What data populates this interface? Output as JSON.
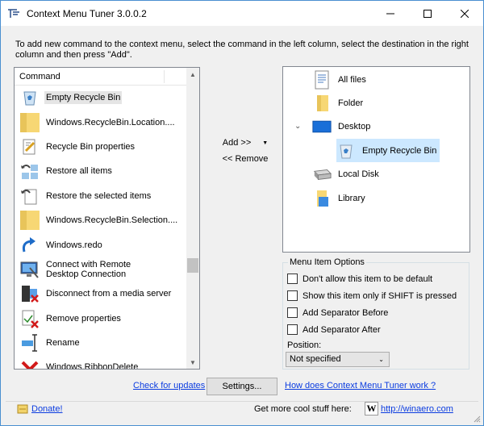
{
  "titlebar": {
    "title": "Context Menu Tuner 3.0.0.2",
    "minimize_icon": "minimize-icon",
    "maximize_icon": "maximize-icon",
    "close_icon": "close-icon"
  },
  "instruction": "To add new command to the context menu, select the command in the left column, select the destination in the right column and then press \"Add\".",
  "command_list": {
    "header": "Command",
    "items": [
      {
        "label": "Empty Recycle Bin",
        "icon": "recycle-bin-icon"
      },
      {
        "label": "Windows.RecycleBin.Location....",
        "icon": "folder-icon"
      },
      {
        "label": "Recycle Bin properties",
        "icon": "properties-icon"
      },
      {
        "label": "Restore all items",
        "icon": "restore-all-icon"
      },
      {
        "label": "Restore the selected items",
        "icon": "restore-selected-icon"
      },
      {
        "label": "Windows.RecycleBin.Selection....",
        "icon": "folder-icon"
      },
      {
        "label": "Windows.redo",
        "icon": "redo-icon"
      },
      {
        "label": "Connect with Remote Desktop Connection",
        "icon": "remote-desktop-icon"
      },
      {
        "label": "Disconnect from a media server",
        "icon": "media-server-icon"
      },
      {
        "label": "Remove properties",
        "icon": "remove-properties-icon"
      },
      {
        "label": "Rename",
        "icon": "rename-icon"
      },
      {
        "label": "Windows.RibbonDelete",
        "icon": "delete-icon"
      }
    ]
  },
  "actions": {
    "add_label": "Add >>",
    "remove_label": "<< Remove"
  },
  "tree": {
    "items": [
      {
        "label": "All files",
        "icon": "all-files-icon"
      },
      {
        "label": "Folder",
        "icon": "folder-icon"
      },
      {
        "label": "Desktop",
        "icon": "desktop-icon"
      },
      {
        "label": "Empty Recycle Bin",
        "icon": "recycle-bin-icon"
      },
      {
        "label": "Local Disk",
        "icon": "local-disk-icon"
      },
      {
        "label": "Library",
        "icon": "library-icon"
      }
    ]
  },
  "options": {
    "legend": "Menu Item Options",
    "checkboxes": [
      "Don't allow this item to be default",
      "Show this item only if SHIFT is pressed",
      "Add Separator Before",
      "Add Separator After"
    ],
    "position_label": "Position:",
    "position_value": "Not specified"
  },
  "bottom": {
    "check_updates": "Check for updates",
    "settings": "Settings...",
    "how_works": "How does Context Menu Tuner work ?",
    "donate": "Donate!",
    "more_stuff": "Get more cool stuff here:",
    "winaero_url": "http://winaero.com"
  }
}
